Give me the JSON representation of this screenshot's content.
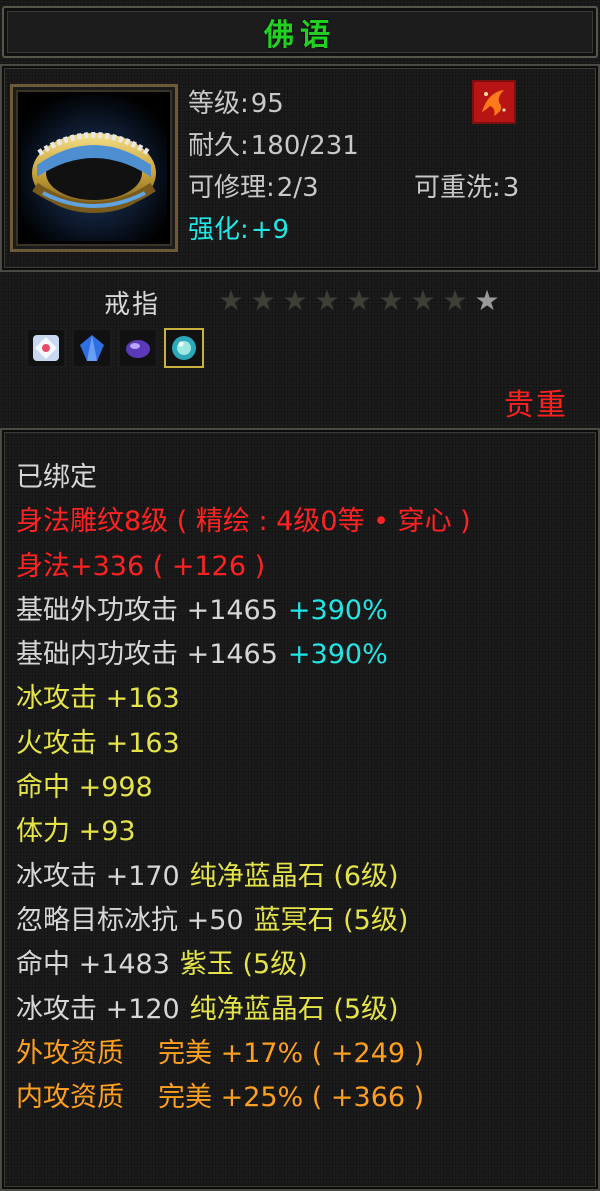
{
  "title": "佛语",
  "item": {
    "icon": "gold-silver-ring-icon",
    "badge_icon": "red-class-emblem-icon",
    "level_label": "等级:",
    "level_value": "95",
    "durability_label": "耐久:",
    "durability_value": "180/231",
    "repair_label": "可修理:",
    "repair_value": "2/3",
    "rewash_label": "可重洗:",
    "rewash_value": "3",
    "enhance_label": "强化:",
    "enhance_value": "+9",
    "type": "戒指",
    "stars_total": 9,
    "stars_lit": 1,
    "rarity": "贵重",
    "gems": [
      "white-crystal-gem-icon",
      "blue-crystal-gem-icon",
      "purple-jade-gem-icon",
      "cyan-orb-gem-icon"
    ]
  },
  "attributes": [
    {
      "parts": [
        {
          "text": "已绑定",
          "color": "white"
        }
      ]
    },
    {
      "parts": [
        {
          "text": "身法雕纹8级 ( 精绘 : 4级0等 • 穿心 )",
          "color": "red"
        }
      ]
    },
    {
      "parts": [
        {
          "text": "身法+336 ( +126 )",
          "color": "red"
        }
      ]
    },
    {
      "parts": [
        {
          "text": "基础外功攻击 +1465",
          "color": "white"
        },
        {
          "text": "+390%",
          "color": "cyan"
        }
      ]
    },
    {
      "parts": [
        {
          "text": "基础内功攻击 +1465",
          "color": "white"
        },
        {
          "text": "+390%",
          "color": "cyan"
        }
      ]
    },
    {
      "parts": [
        {
          "text": "冰攻击 +163",
          "color": "yellow"
        }
      ]
    },
    {
      "parts": [
        {
          "text": "火攻击 +163",
          "color": "yellow"
        }
      ]
    },
    {
      "parts": [
        {
          "text": "命中 +998",
          "color": "yellow"
        }
      ]
    },
    {
      "parts": [
        {
          "text": "体力 +93",
          "color": "yellow"
        }
      ]
    },
    {
      "parts": [
        {
          "text": "冰攻击 +170",
          "color": "white"
        },
        {
          "text": "纯净蓝晶石 (6级)",
          "color": "yellow"
        }
      ]
    },
    {
      "parts": [
        {
          "text": "忽略目标冰抗 +50",
          "color": "white"
        },
        {
          "text": "蓝冥石 (5级)",
          "color": "yellow"
        }
      ]
    },
    {
      "parts": [
        {
          "text": "命中 +1483",
          "color": "white"
        },
        {
          "text": "紫玉 (5级)",
          "color": "yellow"
        }
      ]
    },
    {
      "parts": [
        {
          "text": "冰攻击 +120",
          "color": "white"
        },
        {
          "text": "纯净蓝晶石 (5级)",
          "color": "yellow"
        }
      ]
    },
    {
      "parts": [
        {
          "text": "外攻资质",
          "color": "orange"
        },
        {
          "text": "完美 +17% ( +249 )",
          "color": "orange"
        }
      ]
    },
    {
      "parts": [
        {
          "text": "内攻资质",
          "color": "orange"
        },
        {
          "text": "完美 +25% ( +366 )",
          "color": "orange"
        }
      ]
    }
  ],
  "colors": {
    "title_green": "#22d022",
    "white": "#d6d6d6",
    "red": "#ff2222",
    "yellow": "#e4e44a",
    "cyan": "#23e5e5",
    "orange": "#ff9f1f",
    "rarity_red": "#ff2020"
  }
}
